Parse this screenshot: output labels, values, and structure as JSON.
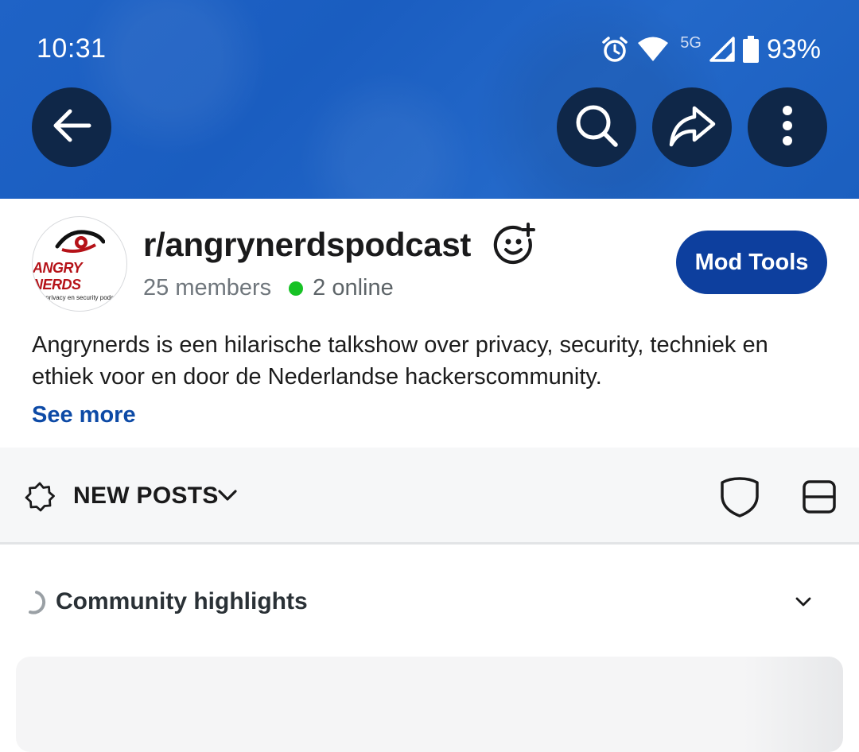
{
  "status_bar": {
    "time": "10:31",
    "network": "5G",
    "battery": "93%"
  },
  "toolbar": {
    "back": "back-arrow-icon",
    "search": "search-icon",
    "share": "share-icon",
    "more": "more-vertical-icon"
  },
  "community": {
    "name": "r/angrynerdspodcast",
    "members": "25 members",
    "online": "2 online",
    "avatar_brand": "ANGRY NERDS",
    "avatar_tagline": "de privacy en security podcast",
    "description": "Angrynerds is een hilarische talkshow over privacy, security, techniek en ethiek voor en door de Nederlandse hackerscommunity.",
    "see_more": "See more",
    "mod_tools": "Mod Tools"
  },
  "sort": {
    "label": "NEW POSTS"
  },
  "highlights": {
    "title": "Community highlights"
  },
  "colors": {
    "banner": "#1f63c6",
    "mod_button": "#0d3f9e",
    "link": "#0d4aa6",
    "online": "#17c225"
  }
}
